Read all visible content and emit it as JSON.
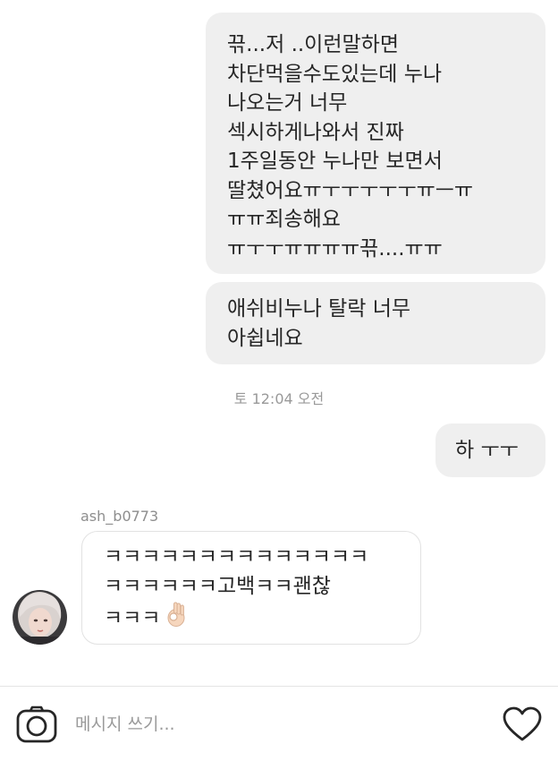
{
  "conversation": {
    "messages_out": [
      "끆...저 ..이런말하면\n차단먹을수도있는데 누나\n나오는거 너무\n섹시하게나와서 진짜\n1주일동안 누나만 보면서\n딸쳤어요ㅠㅜㅜㅜㅜㅜㅠㅡㅠ\nㅠㅠ죄송해요\nㅠㅜㅜㅠㅠㅠㅠ끆....ㅠㅠ",
      "애쉬비누나 탈락 너무\n아쉽네요"
    ],
    "timestamp": "토 12:04 오전",
    "reply_out": "하 ㅜㅜ",
    "incoming": {
      "sender": "ash_b0773",
      "text": "ㅋㅋㅋㅋㅋㅋㅋㅋㅋㅋㅋㅋㅋㅋ\nㅋㅋㅋㅋㅋㅋ고백ㅋㅋ괜찮\nㅋㅋㅋ",
      "emoji": "ok-hand"
    }
  },
  "composer": {
    "placeholder": "메시지 쓰기...",
    "value": "",
    "left_icon": "camera-icon",
    "right_icon": "heart-icon"
  },
  "colors": {
    "bubble_out": "#efefef",
    "text": "#262626",
    "muted": "#999999"
  }
}
